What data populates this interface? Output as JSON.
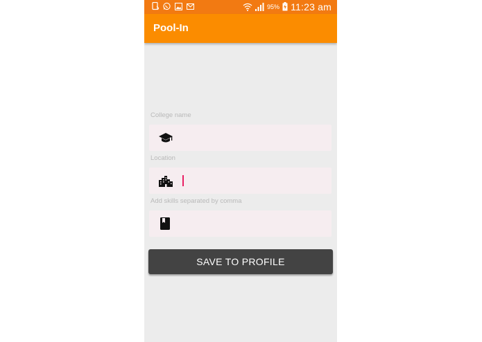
{
  "status_bar": {
    "battery_percent": "95%",
    "time": "11:23 am",
    "background": "#f27a12",
    "left_icons": [
      "device-icon",
      "whatsapp-icon",
      "gallery-icon",
      "gmail-icon"
    ],
    "right_icons": [
      "wifi-icon",
      "signal-icon",
      "battery-charging-icon"
    ]
  },
  "app_bar": {
    "title": "Pool-In",
    "background": "#fb8c00"
  },
  "form": {
    "college": {
      "label": "College name",
      "value": "",
      "icon": "graduation-cap-icon"
    },
    "location": {
      "label": "Location",
      "value": "",
      "icon": "city-icon"
    },
    "skills": {
      "label": "Add skills separated by comma",
      "value": "",
      "icon": "book-icon"
    }
  },
  "actions": {
    "save_label": "SAVE TO PROFILE",
    "button_color": "#434343"
  },
  "colors": {
    "screen_background": "#ececec",
    "field_background": "#f6edf0",
    "cursor": "#e91e63"
  }
}
